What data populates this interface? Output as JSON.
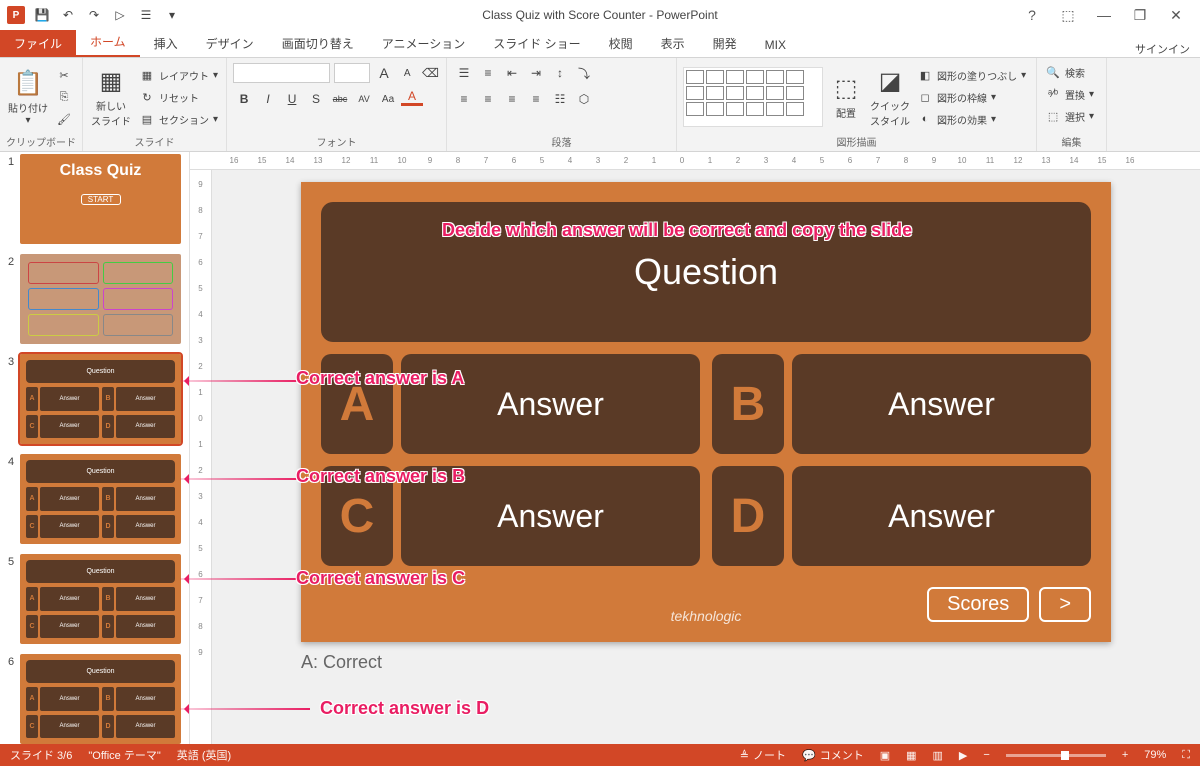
{
  "title": "Class Quiz with Score Counter - PowerPoint",
  "qat": {
    "save": "💾",
    "undo": "↶",
    "redo": "↷",
    "start": "▷",
    "touch": "☰",
    "more": "▾"
  },
  "win": {
    "help": "?",
    "opts": "⬚",
    "min": "—",
    "max": "❐",
    "close": "✕"
  },
  "tabs": {
    "file": "ファイル",
    "home": "ホーム",
    "insert": "挿入",
    "design": "デザイン",
    "transitions": "画面切り替え",
    "animations": "アニメーション",
    "slideshow": "スライド ショー",
    "review": "校閲",
    "view": "表示",
    "developer": "開発",
    "mix": "MIX",
    "signin": "サインイン"
  },
  "ribbon": {
    "clipboard": {
      "label": "クリップボード",
      "paste": "貼り付け",
      "cut": "✂",
      "copy": "⎘",
      "painter": "🖌"
    },
    "slides": {
      "label": "スライド",
      "new": "新しい\nスライド",
      "layout": "レイアウト",
      "reset": "リセット",
      "section": "セクション"
    },
    "font": {
      "label": "フォント",
      "name": "",
      "size": "",
      "grow": "A",
      "shrink": "A",
      "clear": "⌫",
      "bold": "B",
      "italic": "I",
      "underline": "U",
      "shadow": "S",
      "strike": "abc",
      "spacing": "AV",
      "case": "Aa",
      "color": "A"
    },
    "paragraph": {
      "label": "段落"
    },
    "drawing": {
      "label": "図形描画",
      "arrange": "配置",
      "quickstyle": "クイック\nスタイル",
      "fill": "図形の塗りつぶし",
      "outline": "図形の枠線",
      "effects": "図形の効果"
    },
    "editing": {
      "label": "編集",
      "find": "検索",
      "replace": "置換",
      "select": "選択"
    }
  },
  "thumbs": [
    {
      "num": "1",
      "type": "title",
      "title": "Class Quiz",
      "btn": "START"
    },
    {
      "num": "2",
      "type": "score"
    },
    {
      "num": "3",
      "type": "quiz",
      "selected": true
    },
    {
      "num": "4",
      "type": "quiz"
    },
    {
      "num": "5",
      "type": "quiz"
    },
    {
      "num": "6",
      "type": "quiz"
    }
  ],
  "thumb_content": {
    "question": "Question",
    "answer": "Answer",
    "letters": [
      "A",
      "B",
      "C",
      "D"
    ]
  },
  "slide": {
    "question": "Question",
    "answers": [
      {
        "l": "A",
        "t": "Answer"
      },
      {
        "l": "B",
        "t": "Answer"
      },
      {
        "l": "C",
        "t": "Answer"
      },
      {
        "l": "D",
        "t": "Answer"
      }
    ],
    "scores_btn": "Scores",
    "next_btn": ">",
    "brand": "tekhnologic"
  },
  "notes": "A: Correct",
  "annotations": {
    "top": "Decide which answer will be correct and copy the slide",
    "a": "Correct answer is A",
    "b": "Correct answer is B",
    "c": "Correct answer is C",
    "d": "Correct answer is D"
  },
  "ruler_h": [
    "16",
    "15",
    "14",
    "13",
    "12",
    "11",
    "10",
    "9",
    "8",
    "7",
    "6",
    "5",
    "4",
    "3",
    "2",
    "1",
    "0",
    "1",
    "2",
    "3",
    "4",
    "5",
    "6",
    "7",
    "8",
    "9",
    "10",
    "11",
    "12",
    "13",
    "14",
    "15",
    "16"
  ],
  "ruler_v": [
    "9",
    "8",
    "7",
    "6",
    "5",
    "4",
    "3",
    "2",
    "1",
    "0",
    "1",
    "2",
    "3",
    "4",
    "5",
    "6",
    "7",
    "8",
    "9"
  ],
  "status": {
    "slide": "スライド 3/6",
    "theme": "\"Office テーマ\"",
    "lang": "英語 (英国)",
    "notes": "ノート",
    "comments": "コメント",
    "zoom": "79%",
    "plus": "+",
    "minus": "−",
    "fit": "⛶"
  }
}
